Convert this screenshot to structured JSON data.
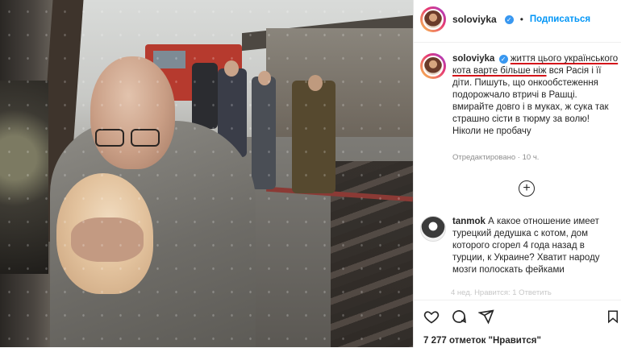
{
  "post": {
    "username": "soloviyka",
    "follow_label": "Подписаться",
    "caption_prefix": "soloviyka",
    "caption_underlined": "життя цього українського кота варте більше ніж",
    "caption_rest": "вся Расія і її діти. Пишуть, що онкообстеження подорожчало втричі в Рашці. вмирайте довго і в муках, ж сука так страшно сісти в тюрму за волю! Ніколи не пробачу",
    "edited_meta": "Отредактировано · 10 ч.",
    "comment_user": "tanmok",
    "comment_text": "А какое отношение имеет турецкий дедушка с котом, дом которого сгорел 4 года назад в турции, к Украине? Хватит народу мозги полоскать фейками",
    "comment_meta": "4 нед. Нравится: 1 Ответить",
    "likes": "7 277 отметок \"Нравится\""
  },
  "icons": [
    "heart-icon",
    "comment-icon",
    "share-icon",
    "bookmark-icon",
    "plus-circle-icon",
    "verified-icon"
  ],
  "colors": {
    "accent": "#0095f6",
    "underline": "#d4141a",
    "text": "#262626",
    "muted": "#8e8e8e"
  }
}
